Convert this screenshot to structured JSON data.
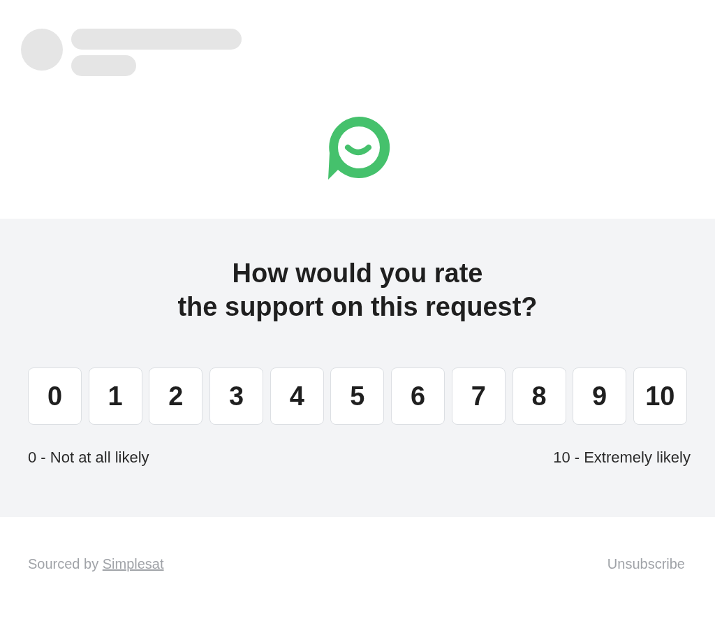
{
  "question_lines": [
    "How would you rate",
    "the support on this request?"
  ],
  "scale": [
    "0",
    "1",
    "2",
    "3",
    "4",
    "5",
    "6",
    "7",
    "8",
    "9",
    "10"
  ],
  "scale_labels": {
    "low": "0 - Not at all likely",
    "high": "10 - Extremely likely"
  },
  "footer": {
    "credit_prefix": "Sourced by",
    "credit_link": "Simplesat",
    "unsubscribe": "Unsubscribe"
  }
}
